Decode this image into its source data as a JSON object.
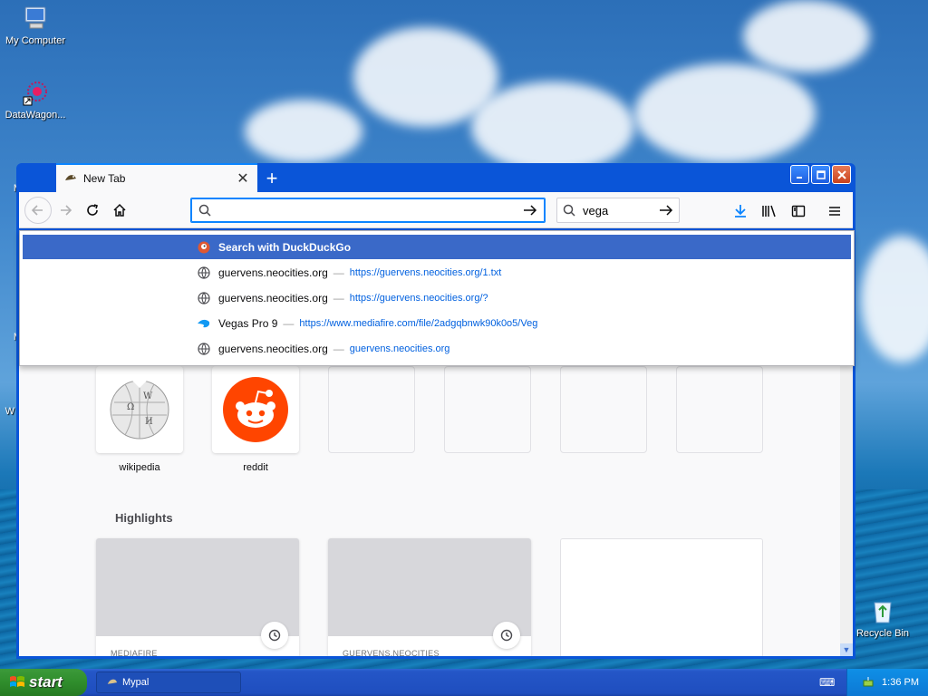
{
  "desktop": {
    "icons": [
      {
        "label": "My Computer"
      },
      {
        "label": "DataWagon..."
      },
      {
        "label": "Recycle Bin"
      }
    ],
    "partial_labels": [
      "Mic",
      "Mic",
      "W"
    ]
  },
  "browser": {
    "tab": {
      "title": "New Tab",
      "close": "✕"
    },
    "new_tab": "+",
    "urlbar": {
      "value": "",
      "placeholder": ""
    },
    "searchbar": {
      "value": "vega"
    },
    "suggestions": [
      {
        "title": "Search with DuckDuckGo",
        "url": "",
        "icon": "duckduckgo-icon",
        "selected": true
      },
      {
        "title": "guervens.neocities.org",
        "url": "https://guervens.neocities.org/1.txt",
        "icon": "globe-icon"
      },
      {
        "title": "guervens.neocities.org",
        "url": "https://guervens.neocities.org/?",
        "icon": "globe-icon"
      },
      {
        "title": "Vegas Pro 9",
        "url": "https://www.mediafire.com/file/2adgqbnwk90k0o5/Veg",
        "icon": "mediafire-icon"
      },
      {
        "title": "guervens.neocities.org",
        "url": "guervens.neocities.org",
        "icon": "globe-icon"
      }
    ],
    "top_sites": [
      {
        "label": "wikipedia"
      },
      {
        "label": "reddit"
      }
    ],
    "highlights": {
      "title": "Highlights",
      "cards": [
        {
          "source": "MEDIAFIRE"
        },
        {
          "source": "GUERVENS.NEOCITIES"
        }
      ]
    }
  },
  "taskbar": {
    "start": "start",
    "task": "Mypal",
    "time": "1:36 PM"
  },
  "colors": {
    "accent": "#0a84ff",
    "selection": "#3a69c8",
    "reddit": "#ff4500",
    "xp_blue": "#0a55d8"
  }
}
